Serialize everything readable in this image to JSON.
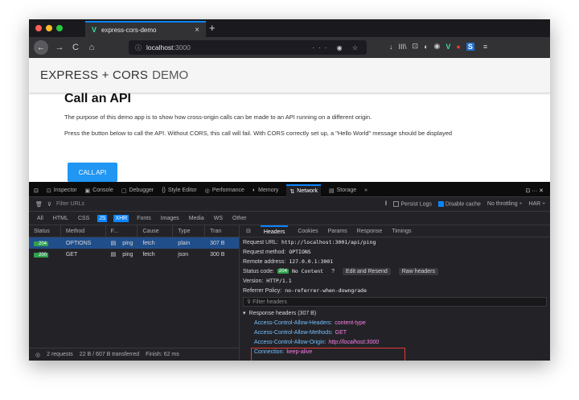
{
  "browser": {
    "tab_title": "express-cors-demo",
    "tab_close": "×",
    "new_tab": "+",
    "url_host": "localhost",
    "url_port": ":3000",
    "url_info_icon": "ⓘ",
    "url_icons": "··· ◉ ☆",
    "nav_back": "←",
    "nav_forward": "→",
    "nav_reload": "C",
    "nav_home": "⌂",
    "toolbar_icons": [
      "↓",
      "III\\",
      "⊡",
      "◐",
      "◉",
      "V",
      "●",
      "S",
      "≡"
    ],
    "traffic_colors": [
      "#ff5f57",
      "#febc2e",
      "#28c840"
    ]
  },
  "page": {
    "brand_main": "EXPRESS + CORS",
    "brand_sub": "DEMO",
    "heading": "Call an API",
    "para1": "The purpose of this demo app is to show how cross-origin calls can be made to an API running on a different origin.",
    "para2": "Press the button below to call the API. Without CORS, this call will fail. With CORS correctly set up, a \"Hello World\" message should be displayed",
    "button": "CALL API"
  },
  "devtools": {
    "tabs": [
      {
        "icon": "⊡",
        "label": "Inspector"
      },
      {
        "icon": "▣",
        "label": "Console"
      },
      {
        "icon": "▢",
        "label": "Debugger"
      },
      {
        "icon": "{}",
        "label": "Style Editor"
      },
      {
        "icon": "◎",
        "label": "Performance"
      },
      {
        "icon": "◐",
        "label": "Memory"
      },
      {
        "icon": "⇅",
        "label": "Network"
      },
      {
        "icon": "▤",
        "label": "Storage"
      }
    ],
    "more": "»",
    "right_icons": "⊡ ··· ✕",
    "filter_placeholder": "Filter URLs",
    "pause": "‖",
    "persist_logs": "Persist Logs",
    "disable_cache": "Disable cache",
    "throttling": "No throttling ÷",
    "har": "HAR ÷",
    "types": [
      "All",
      "HTML",
      "CSS",
      "JS",
      "XHR",
      "Fonts",
      "Images",
      "Media",
      "WS",
      "Other"
    ],
    "columns": [
      "Status",
      "Method",
      "F...",
      "Cause",
      "Type",
      "Tran"
    ],
    "requests": [
      {
        "status": "204",
        "method": "OPTIONS",
        "file": "ping",
        "cause": "fetch",
        "type": "plain",
        "size": "307 B"
      },
      {
        "status": "200",
        "method": "GET",
        "file": "ping",
        "cause": "fetch",
        "type": "json",
        "size": "300 B"
      }
    ],
    "summary": [
      "2 requests",
      "22 B / 607 B transferred",
      "Finish: 62 ms"
    ],
    "detail_tabs": [
      "Headers",
      "Cookies",
      "Params",
      "Response",
      "Timings"
    ],
    "request_url_label": "Request URL:",
    "request_url": "http://localhost:3001/api/ping",
    "request_method_label": "Request method:",
    "request_method": "OPTIONS",
    "remote_label": "Remote address:",
    "remote": "127.0.0.1:3001",
    "status_label": "Status code:",
    "status_code": "204",
    "status_text": "No Content",
    "edit_resend": "Edit and Resend",
    "raw_headers": "Raw headers",
    "version_label": "Version:",
    "version": "HTTP/1.1",
    "referrer_label": "Referrer Policy:",
    "referrer": "no-referrer-when-downgrade",
    "headers_filter": "Filter headers",
    "response_headers": "Response headers (307 B)",
    "headers": [
      {
        "k": "Access-Control-Allow-Headers:",
        "v": "content-type"
      },
      {
        "k": "Access-Control-Allow-Methods:",
        "v": "GET"
      },
      {
        "k": "Access-Control-Allow-Origin:",
        "v": "http://localhost:3000"
      },
      {
        "k": "Connection:",
        "v": "keep-alive"
      }
    ]
  }
}
